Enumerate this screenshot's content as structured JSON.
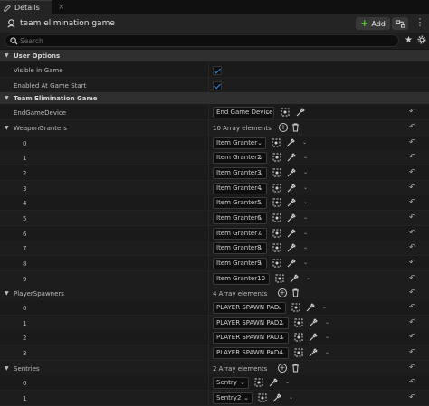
{
  "tab": {
    "label": "Details",
    "close": "×"
  },
  "header": {
    "title": "team elimination game",
    "add_label": "Add",
    "menu": "⋮"
  },
  "search": {
    "placeholder": "Search"
  },
  "sections": {
    "user_options": "User Options",
    "team_elimination": "Team Elimination Game"
  },
  "user_options": {
    "visible_label": "Visible in Game",
    "visible_checked": true,
    "enabled_label": "Enabled At Game Start",
    "enabled_checked": true
  },
  "props": {
    "end_game_label": "EndGameDevice",
    "end_game_value": "End Game Device",
    "weapon_label": "WeaponGranters",
    "weapon_count": "10 Array elements",
    "player_label": "PlayerSpawners",
    "player_count": "4 Array elements",
    "sentries_label": "Sentries",
    "sentries_count": "2 Array elements"
  },
  "weapon_granters": [
    {
      "index": "0",
      "value": "Item Granter"
    },
    {
      "index": "1",
      "value": "Item Granter2"
    },
    {
      "index": "2",
      "value": "Item Granter3"
    },
    {
      "index": "3",
      "value": "Item Granter4"
    },
    {
      "index": "4",
      "value": "Item Granter5"
    },
    {
      "index": "5",
      "value": "Item Granter6"
    },
    {
      "index": "6",
      "value": "Item Granter7"
    },
    {
      "index": "7",
      "value": "Item Granter8"
    },
    {
      "index": "8",
      "value": "Item Granter9"
    },
    {
      "index": "9",
      "value": "Item Granter10"
    }
  ],
  "player_spawners": [
    {
      "index": "0",
      "value": "PLAYER SPAWN PAD"
    },
    {
      "index": "1",
      "value": "PLAYER SPAWN PAD2"
    },
    {
      "index": "2",
      "value": "PLAYER SPAWN PAD3"
    },
    {
      "index": "3",
      "value": "PLAYER SPAWN PAD4"
    }
  ],
  "sentries": [
    {
      "index": "0",
      "value": "Sentry"
    },
    {
      "index": "1",
      "value": "Sentry2"
    }
  ],
  "icons": {
    "reset": "↶",
    "chevron_down": "▼",
    "chevron_right": "▶",
    "combo_arrow": "⌄"
  },
  "colors": {
    "accent_blue": "#3b8ee8",
    "add_green": "#5bbf3a",
    "panel": "#1a1a1a",
    "section": "#2f2f2f"
  }
}
